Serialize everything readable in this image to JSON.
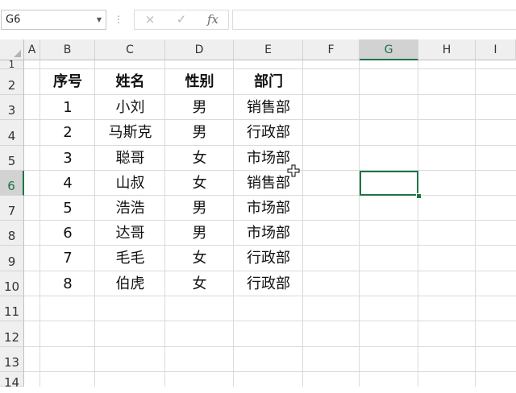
{
  "formula_bar": {
    "name_box": "G6",
    "cancel_icon": "×",
    "enter_icon": "✓",
    "fx_label": "fx",
    "formula": ""
  },
  "columns": [
    "A",
    "B",
    "C",
    "D",
    "E",
    "F",
    "G",
    "H",
    "I"
  ],
  "rows": [
    "1",
    "2",
    "3",
    "4",
    "5",
    "6",
    "7",
    "8",
    "9",
    "10",
    "11",
    "12",
    "13",
    "14"
  ],
  "selected_cell": "G6",
  "table": {
    "headers": [
      "序号",
      "姓名",
      "性别",
      "部门"
    ],
    "records": [
      [
        "1",
        "小刘",
        "男",
        "销售部"
      ],
      [
        "2",
        "马斯克",
        "男",
        "行政部"
      ],
      [
        "3",
        "聪哥",
        "女",
        "市场部"
      ],
      [
        "4",
        "山叔",
        "女",
        "销售部"
      ],
      [
        "5",
        "浩浩",
        "男",
        "市场部"
      ],
      [
        "6",
        "达哥",
        "男",
        "市场部"
      ],
      [
        "7",
        "毛毛",
        "女",
        "行政部"
      ],
      [
        "8",
        "伯虎",
        "女",
        "行政部"
      ]
    ]
  },
  "colors": {
    "accent": "#217346",
    "header_bg": "#efefef",
    "gridline": "#dadada"
  }
}
